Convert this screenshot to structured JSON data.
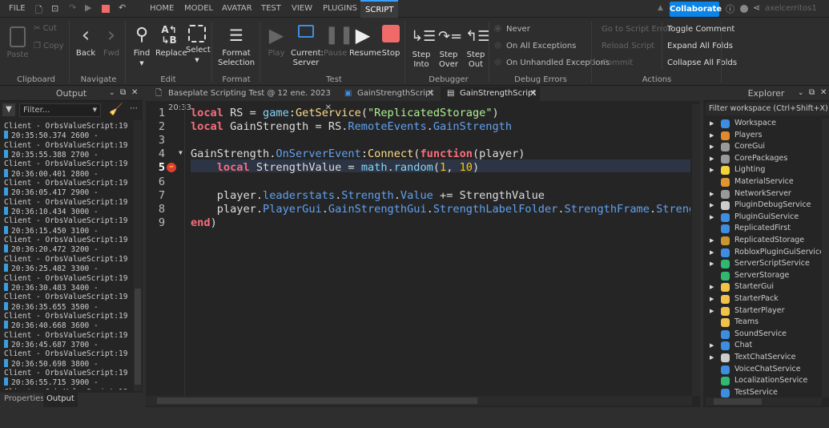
{
  "menubar": {
    "items": [
      "FILE",
      "HOME",
      "MODEL",
      "AVATAR",
      "TEST",
      "VIEW",
      "PLUGINS",
      "SCRIPT"
    ],
    "active": "SCRIPT",
    "collaborate": "Collaborate",
    "username": "axelcerritos1"
  },
  "ribbon": {
    "clipboard": {
      "paste": "Paste",
      "cut": "Cut",
      "copy": "Copy",
      "group": "Clipboard"
    },
    "navigate": {
      "back": "Back",
      "fwd": "Fwd",
      "group": "Navigate"
    },
    "edit": {
      "find": "Find",
      "replace": "Replace",
      "select": "Select",
      "group": "Edit"
    },
    "format": {
      "label1": "Format",
      "label2": "Selection",
      "group": "Format"
    },
    "test": {
      "play": "Play",
      "current1": "Current:",
      "current2": "Server",
      "pause": "Pause",
      "resume": "Resume",
      "stop": "Stop",
      "group": "Test"
    },
    "debugger": {
      "into1": "Step",
      "into2": "Into",
      "over1": "Step",
      "over2": "Over",
      "out1": "Step",
      "out2": "Out",
      "group": "Debugger"
    },
    "debug_errors": {
      "options": [
        "Never",
        "On All Exceptions",
        "On Unhandled Exceptions"
      ],
      "selected": "Never",
      "group": "Debug Errors"
    },
    "actions": {
      "goto": "Go to Script Error",
      "reload": "Reload Script",
      "commit": "Commit",
      "toggle": "Toggle Comment",
      "expand": "Expand All Folds",
      "collapse": "Collapse All Folds",
      "group": "Actions"
    }
  },
  "output": {
    "title": "Output",
    "filter_placeholder": "Filter...",
    "source": "Client - OrbsValueScript:19",
    "entries": [
      {
        "time": "20:35:50.374",
        "value": "2600"
      },
      {
        "time": "20:35:55.388",
        "value": "2700"
      },
      {
        "time": "20:36:00.401",
        "value": "2800"
      },
      {
        "time": "20:36:05.417",
        "value": "2900"
      },
      {
        "time": "20:36:10.434",
        "value": "3000"
      },
      {
        "time": "20:36:15.450",
        "value": "3100"
      },
      {
        "time": "20:36:20.472",
        "value": "3200"
      },
      {
        "time": "20:36:25.482",
        "value": "3300"
      },
      {
        "time": "20:36:30.483",
        "value": "3400"
      },
      {
        "time": "20:36:35.655",
        "value": "3500"
      },
      {
        "time": "20:36:40.668",
        "value": "3600"
      },
      {
        "time": "20:36:45.687",
        "value": "3700"
      },
      {
        "time": "20:36:50.698",
        "value": "3800"
      },
      {
        "time": "20:36:55.715",
        "value": "3900"
      }
    ],
    "bottom_tabs": [
      "Properties",
      "Output"
    ]
  },
  "editor": {
    "tabs": [
      "Baseplate Scripting Test @ 12 ene. 2023 20:33",
      "GainStrengthScript",
      "GainStrengthScript"
    ],
    "active_tab": 2,
    "breakpoint_line": 5,
    "lines": [
      [
        [
          "local",
          "kw"
        ],
        [
          " RS = ",
          ""
        ],
        [
          "game",
          "gl"
        ],
        [
          ":",
          ""
        ],
        [
          "GetService",
          "fn"
        ],
        [
          "(",
          ""
        ],
        [
          "\"ReplicatedStorage\"",
          "str"
        ],
        [
          ")",
          ""
        ]
      ],
      [
        [
          "local",
          "kw"
        ],
        [
          " GainStrength = RS.",
          ""
        ],
        [
          "RemoteEvents",
          "prop"
        ],
        [
          ".",
          ""
        ],
        [
          "GainStrength",
          "prop"
        ]
      ],
      [],
      [
        [
          "GainStrength.",
          ""
        ],
        [
          "OnServerEvent",
          "prop"
        ],
        [
          ":",
          ""
        ],
        [
          "Connect",
          "fn"
        ],
        [
          "(",
          ""
        ],
        [
          "function",
          "kw"
        ],
        [
          "(player)",
          ""
        ]
      ],
      [
        [
          "    ",
          ""
        ],
        [
          "local",
          "kw"
        ],
        [
          " StrengthValue = ",
          ""
        ],
        [
          "math",
          "gl"
        ],
        [
          ".",
          ""
        ],
        [
          "random",
          "gl"
        ],
        [
          "(",
          ""
        ],
        [
          "1",
          "num"
        ],
        [
          ", ",
          ""
        ],
        [
          "10",
          "num"
        ],
        [
          ")",
          ""
        ]
      ],
      [],
      [
        [
          "    player.",
          ""
        ],
        [
          "leaderstats",
          "prop"
        ],
        [
          ".",
          ""
        ],
        [
          "Strength",
          "prop"
        ],
        [
          ".",
          ""
        ],
        [
          "Value",
          "prop"
        ],
        [
          " += StrengthValue",
          ""
        ]
      ],
      [
        [
          "    player.",
          ""
        ],
        [
          "PlayerGui",
          "prop"
        ],
        [
          ".",
          ""
        ],
        [
          "GainStrengthGui",
          "prop"
        ],
        [
          ".",
          ""
        ],
        [
          "StrengthLabelFolder",
          "prop"
        ],
        [
          ".",
          ""
        ],
        [
          "StrengthFrame",
          "prop"
        ],
        [
          ".",
          ""
        ],
        [
          "StrengthLabel",
          "prop"
        ]
      ],
      [
        [
          "end",
          "kw"
        ],
        [
          ")",
          ""
        ]
      ]
    ]
  },
  "explorer": {
    "title": "Explorer",
    "filter_placeholder": "Filter workspace (Ctrl+Shift+X)",
    "items": [
      {
        "name": "Workspace",
        "expandable": true,
        "color": "#3d8ee0"
      },
      {
        "name": "Players",
        "expandable": true,
        "color": "#e08a2e"
      },
      {
        "name": "CoreGui",
        "expandable": true,
        "color": "#999999"
      },
      {
        "name": "CorePackages",
        "expandable": true,
        "color": "#999999"
      },
      {
        "name": "Lighting",
        "expandable": true,
        "color": "#f3d33a"
      },
      {
        "name": "MaterialService",
        "expandable": false,
        "color": "#e0952e"
      },
      {
        "name": "NetworkServer",
        "expandable": true,
        "color": "#999999"
      },
      {
        "name": "PluginDebugService",
        "expandable": true,
        "color": "#cccccc"
      },
      {
        "name": "PluginGuiService",
        "expandable": true,
        "color": "#3d8ee0"
      },
      {
        "name": "ReplicatedFirst",
        "expandable": false,
        "color": "#3d8ee0"
      },
      {
        "name": "ReplicatedStorage",
        "expandable": true,
        "color": "#c9962e"
      },
      {
        "name": "RobloxPluginGuiService",
        "expandable": true,
        "color": "#3d8ee0"
      },
      {
        "name": "ServerScriptService",
        "expandable": true,
        "color": "#2eb872"
      },
      {
        "name": "ServerStorage",
        "expandable": false,
        "color": "#2eb872"
      },
      {
        "name": "StarterGui",
        "expandable": true,
        "color": "#f0c24a"
      },
      {
        "name": "StarterPack",
        "expandable": true,
        "color": "#f0c24a"
      },
      {
        "name": "StarterPlayer",
        "expandable": true,
        "color": "#f0c24a"
      },
      {
        "name": "Teams",
        "expandable": false,
        "color": "#f0c24a"
      },
      {
        "name": "SoundService",
        "expandable": false,
        "color": "#3d8ee0"
      },
      {
        "name": "Chat",
        "expandable": true,
        "color": "#3d8ee0"
      },
      {
        "name": "TextChatService",
        "expandable": true,
        "color": "#cccccc"
      },
      {
        "name": "VoiceChatService",
        "expandable": false,
        "color": "#3d8ee0"
      },
      {
        "name": "LocalizationService",
        "expandable": false,
        "color": "#2eb872"
      },
      {
        "name": "TestService",
        "expandable": false,
        "color": "#3d8ee0"
      }
    ]
  }
}
